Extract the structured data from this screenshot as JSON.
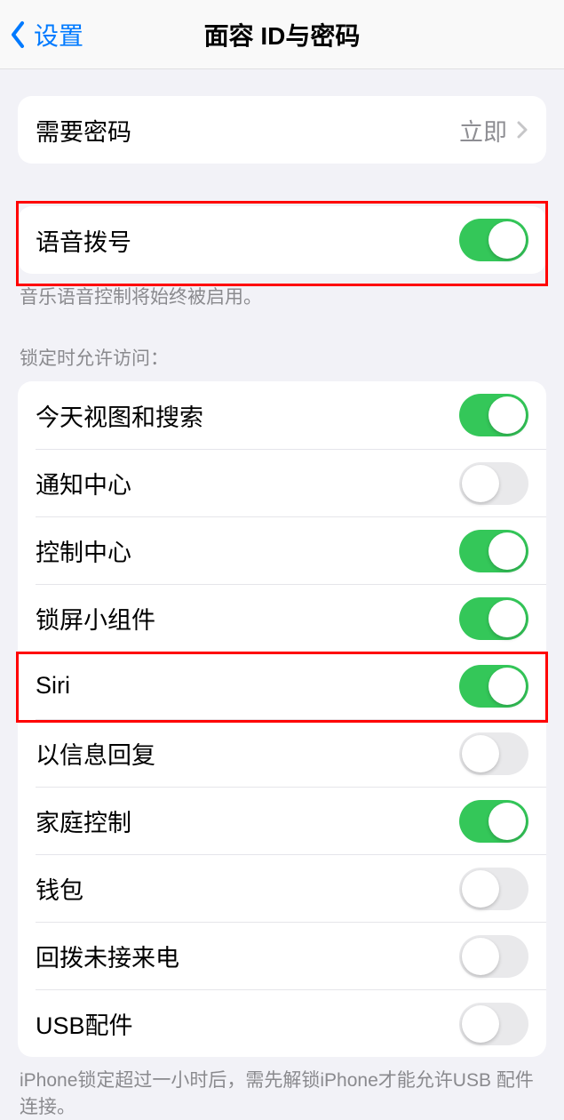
{
  "nav": {
    "back_label": "设置",
    "title": "面容 ID与密码"
  },
  "require_passcode": {
    "label": "需要密码",
    "value": "立即"
  },
  "voice_dial": {
    "label": "语音拨号",
    "on": true,
    "footer": "音乐语音控制将始终被启用。"
  },
  "lock_access": {
    "header": "锁定时允许访问：",
    "items": [
      {
        "label": "今天视图和搜索",
        "on": true
      },
      {
        "label": "通知中心",
        "on": false
      },
      {
        "label": "控制中心",
        "on": true
      },
      {
        "label": "锁屏小组件",
        "on": true
      },
      {
        "label": "Siri",
        "on": true
      },
      {
        "label": "以信息回复",
        "on": false
      },
      {
        "label": "家庭控制",
        "on": true
      },
      {
        "label": "钱包",
        "on": false
      },
      {
        "label": "回拨未接来电",
        "on": false
      },
      {
        "label": "USB配件",
        "on": false
      }
    ],
    "footer": "iPhone锁定超过一小时后，需先解锁iPhone才能允许USB 配件连接。"
  }
}
